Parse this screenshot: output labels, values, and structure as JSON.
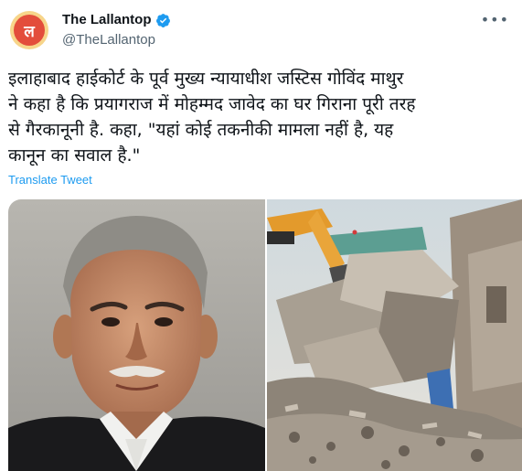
{
  "author": {
    "display_name": "The Lallantop",
    "handle": "@TheLallantop",
    "avatar_glyph": "ल",
    "verified": true
  },
  "menu": {
    "more_label": "•••"
  },
  "tweet": {
    "lines": [
      "इलाहाबाद हाईकोर्ट के पूर्व मुख्य न्यायाधीश जस्टिस गोविंद माथुर",
      "ने कहा है कि प्रयागराज में मोहम्मद जावेद का घर गिराना पूरी तरह",
      "से गैरकानूनी है. कहा, \"यहां कोई तकनीकी मामला नहीं है, यह",
      "कानून का सवाल है.\""
    ],
    "translate_label": "Translate Tweet"
  },
  "colors": {
    "link": "#1d9bf0",
    "verified": "#1d9bf0",
    "secondary_text": "#536471",
    "avatar_ring": "#f7d58a",
    "avatar_fill": "#e34d3b"
  },
  "media": {
    "images": [
      {
        "name": "portrait-photo"
      },
      {
        "name": "demolition-photo"
      }
    ]
  }
}
